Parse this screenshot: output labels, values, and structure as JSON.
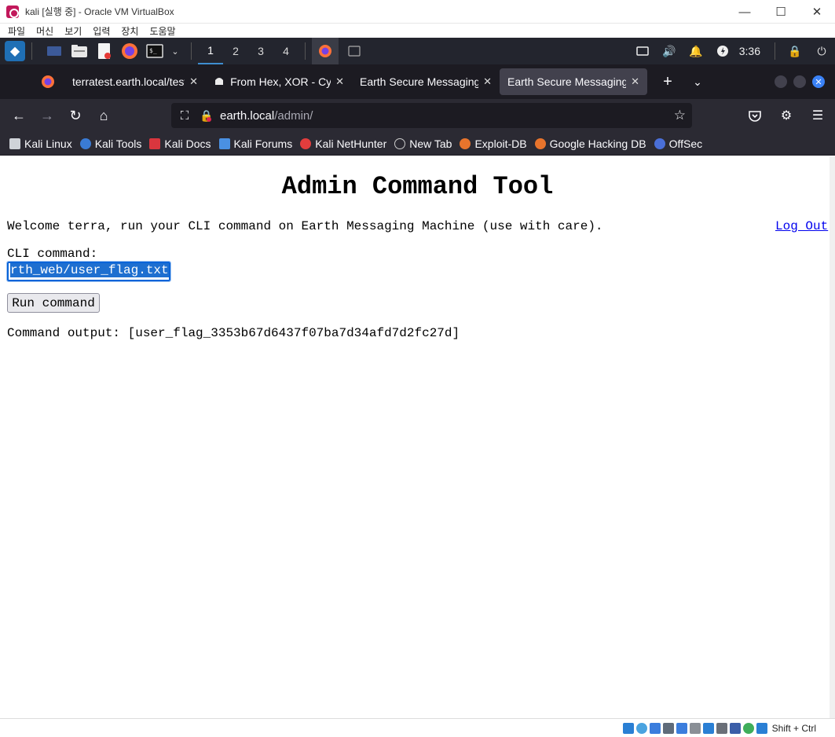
{
  "vbox": {
    "title": "kali [실행 중] - Oracle VM VirtualBox",
    "menu": [
      "파일",
      "머신",
      "보기",
      "입력",
      "장치",
      "도움말"
    ],
    "host_key": "Shift + Ctrl"
  },
  "panel": {
    "workspaces": [
      "1",
      "2",
      "3",
      "4"
    ],
    "active_workspace": "1",
    "clock": "3:36"
  },
  "browser": {
    "tabs": [
      {
        "label": "terratest.earth.local/test"
      },
      {
        "label": "From Hex, XOR - Cyb"
      },
      {
        "label": "Earth Secure Messaging"
      },
      {
        "label": "Earth Secure Messaging"
      }
    ],
    "active_tab": 3,
    "url": {
      "host": "earth.local",
      "path": "/admin/"
    },
    "bookmarks": [
      {
        "label": "Kali Linux",
        "icon": "kali-dragon-icon",
        "color": "#cfd3d8"
      },
      {
        "label": "Kali Tools",
        "icon": "kali-tools-icon",
        "color": "#3a7bd5"
      },
      {
        "label": "Kali Docs",
        "icon": "kali-docs-icon",
        "color": "#d9363e"
      },
      {
        "label": "Kali Forums",
        "icon": "kali-forums-icon",
        "color": "#4a90e2"
      },
      {
        "label": "Kali NetHunter",
        "icon": "nethunter-icon",
        "color": "#e23d3d"
      },
      {
        "label": "New Tab",
        "icon": "globe-icon",
        "color": "#cccccc"
      },
      {
        "label": "Exploit-DB",
        "icon": "exploit-db-icon",
        "color": "#e8742c"
      },
      {
        "label": "Google Hacking DB",
        "icon": "ghdb-icon",
        "color": "#e8742c"
      },
      {
        "label": "OffSec",
        "icon": "offsec-icon",
        "color": "#4a6fd8"
      }
    ]
  },
  "page": {
    "title": "Admin Command Tool",
    "welcome": "Welcome terra, run your CLI command on Earth Messaging Machine (use with care).",
    "logout": "Log Out",
    "cli_label": "CLI command:",
    "cli_value": "rth_web/user_flag.txt",
    "run_button": "Run command",
    "output": "Command output: [user_flag_3353b67d6437f07ba7d34afd7d2fc27d]"
  }
}
